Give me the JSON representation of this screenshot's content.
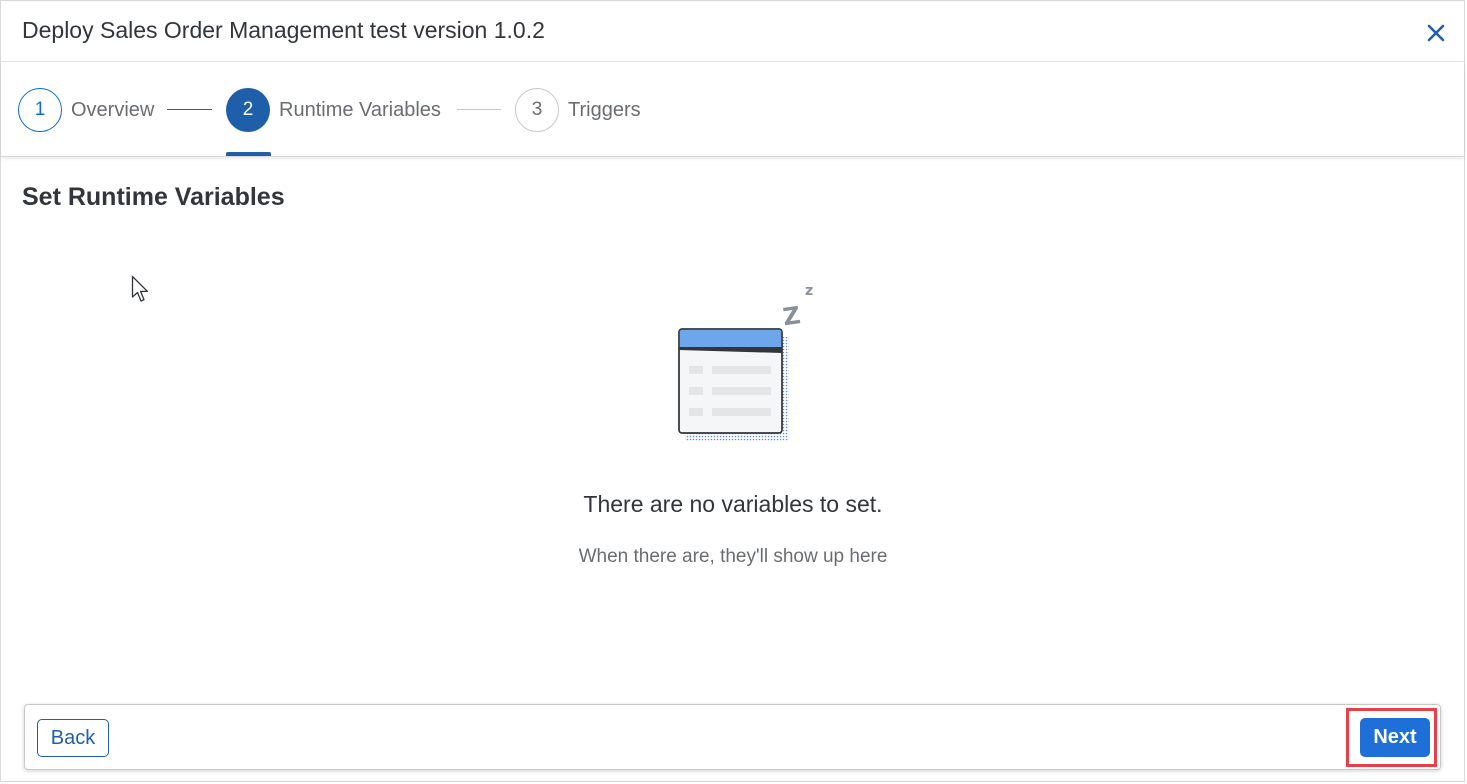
{
  "dialog": {
    "title": "Deploy Sales Order Management test version 1.0.2",
    "close_icon": "close-icon"
  },
  "wizard": {
    "steps": [
      {
        "number": "1",
        "label": "Overview",
        "state": "completed"
      },
      {
        "number": "2",
        "label": "Runtime Variables",
        "state": "active"
      },
      {
        "number": "3",
        "label": "Triggers",
        "state": "pending"
      }
    ]
  },
  "content": {
    "section_title": "Set Runtime Variables",
    "empty_state": {
      "illustration": "sleeping-table-illustration",
      "title": "There are no variables to set.",
      "subtitle": "When there are, they'll show up here"
    }
  },
  "footer": {
    "back_label": "Back",
    "next_label": "Next"
  },
  "colors": {
    "accent": "#1f5fa9",
    "next_button": "#1f6fd8",
    "highlight_box": "#e8404a"
  }
}
